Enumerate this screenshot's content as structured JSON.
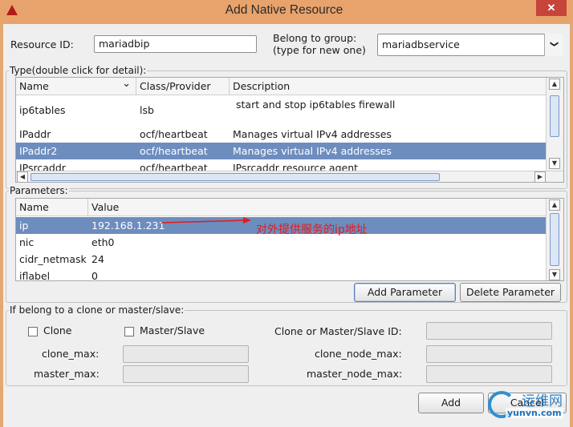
{
  "window": {
    "title": "Add Native Resource",
    "close_symbol": "✕"
  },
  "top": {
    "resource_id_label": "Resource ID:",
    "resource_id_value": "mariadbip",
    "group_label_line1": "Belong to group:",
    "group_label_line2": "(type for new one)",
    "group_value": "mariadbservice",
    "dropdown_symbol": "❯"
  },
  "type_section": {
    "title": "Type(double click for detail):",
    "columns": [
      "Name",
      "Class/Provider",
      "Description"
    ],
    "sort_symbol": "⌄",
    "rows": [
      {
        "name": "ip6tables",
        "provider": "lsb",
        "description": "start and stop ip6tables firewall"
      },
      {
        "name": "IPaddr",
        "provider": "ocf/heartbeat",
        "description": "Manages virtual IPv4 addresses"
      },
      {
        "name": "IPaddr2",
        "provider": "ocf/heartbeat",
        "description": "Manages virtual IPv4 addresses"
      },
      {
        "name": "IPsrcaddr",
        "provider": "ocf/heartbeat",
        "description": "IPsrcaddr resource agent"
      }
    ],
    "selected_index": 2
  },
  "params_section": {
    "title": "Parameters:",
    "columns": [
      "Name",
      "Value"
    ],
    "rows": [
      {
        "name": "ip",
        "value": "192.168.1.231"
      },
      {
        "name": "nic",
        "value": "eth0"
      },
      {
        "name": "cidr_netmask",
        "value": "24"
      },
      {
        "name": "iflabel",
        "value": "0"
      }
    ],
    "selected_index": 0,
    "add_button": "Add Parameter",
    "delete_button": "Delete Parameter",
    "annotation": "对外提供服务的ip地址",
    "annotation_color": "#e31b1b"
  },
  "clone_section": {
    "title": "If belong to a clone or master/slave:",
    "clone_label": "Clone",
    "master_slave_label": "Master/Slave",
    "clone_id_label": "Clone or Master/Slave ID:",
    "clone_max_label": "clone_max:",
    "clone_node_max_label": "clone_node_max:",
    "master_max_label": "master_max:",
    "master_node_max_label": "master_node_max:"
  },
  "footer": {
    "add_button": "Add",
    "cancel_button": "Cancel"
  },
  "watermark": {
    "title": "运维网",
    "url": "yunvn.com"
  },
  "colors": {
    "selection": "#6d8dbe",
    "titlebar": "#e8a36c",
    "dialog_bg": "#efefef"
  }
}
